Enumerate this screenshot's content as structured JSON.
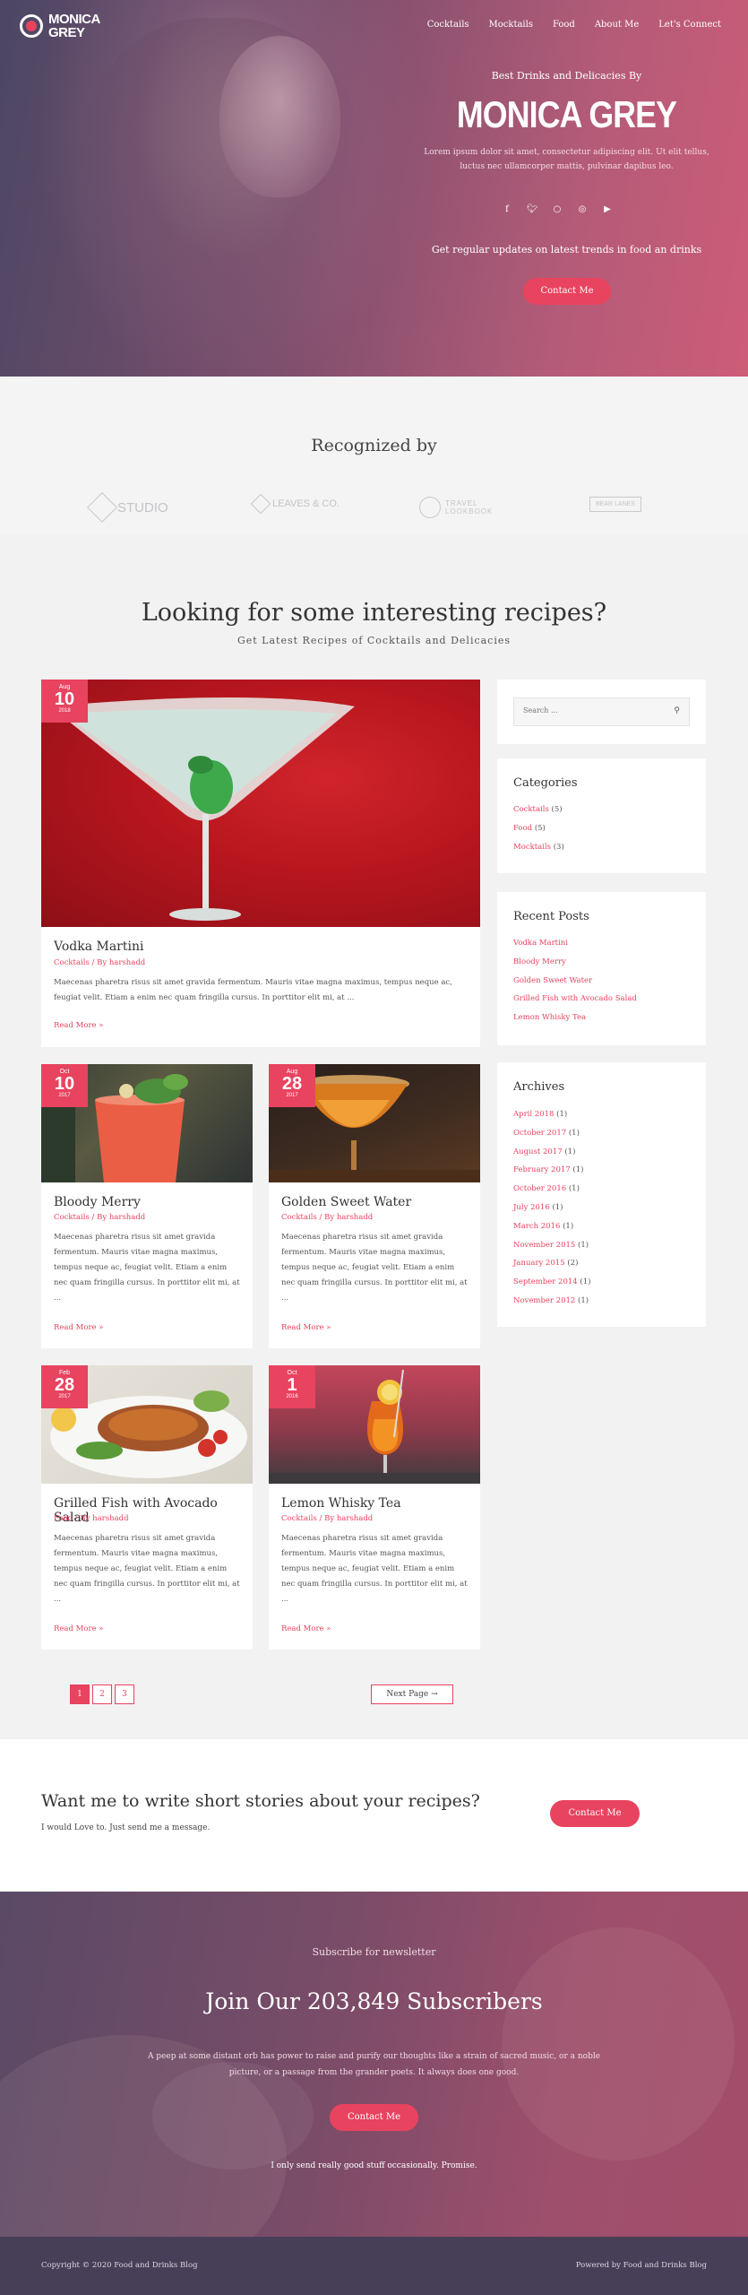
{
  "brand": {
    "line1": "MONICA",
    "line2": "GREY"
  },
  "nav": [
    "Cocktails",
    "Mocktails",
    "Food",
    "About Me",
    "Let's Connect"
  ],
  "hero": {
    "kicker": "Best Drinks and Delicacies By",
    "title": "MONICA GREY",
    "desc": "Lorem ipsum dolor sit amet, consectetur adipiscing elit. Ut elit tellus, luctus nec ullamcorper mattis, pulvinar dapibus leo.",
    "social_icons": [
      "facebook-icon",
      "twitter-icon",
      "instagram-icon",
      "tripadvisor-icon",
      "youtube-icon"
    ],
    "updates": "Get regular updates on latest trends in food an drinks",
    "button": "Contact Me"
  },
  "recognized": {
    "title": "Recognized by",
    "logos": [
      "STUDIO",
      "LEAVES & CO.",
      "TRAVEL LOOKBOOK",
      "BEAR LANES"
    ]
  },
  "recipes": {
    "title": "Looking for some interesting recipes?",
    "subtitle": "Get Latest Recipes of Cocktails and Delicacies"
  },
  "posts": [
    {
      "title": "Vodka Martini",
      "meta": "Cocktails / By harshadd",
      "month": "Aug",
      "day": "10",
      "year": "2018",
      "excerpt": "Maecenas pharetra risus sit amet gravida fermentum. Mauris vitae magna maximus, tempus neque ac, feugiat velit. Etiam a enim nec quam fringilla cursus. In porttitor elit mi, at ...",
      "more": "Read More »"
    },
    {
      "title": "Bloody Merry",
      "meta": "Cocktails / By harshadd",
      "month": "Oct",
      "day": "10",
      "year": "2017",
      "excerpt": "Maecenas pharetra risus sit amet gravida fermentum. Mauris vitae magna maximus, tempus neque ac, feugiat velit. Etiam a enim nec quam fringilla cursus. In porttitor elit mi, at ...",
      "more": "Read More »"
    },
    {
      "title": "Golden Sweet Water",
      "meta": "Cocktails / By harshadd",
      "month": "Aug",
      "day": "28",
      "year": "2017",
      "excerpt": "Maecenas pharetra risus sit amet gravida fermentum. Mauris vitae magna maximus, tempus neque ac, feugiat velit. Etiam a enim nec quam fringilla cursus. In porttitor elit mi, at ...",
      "more": "Read More »"
    },
    {
      "title": "Grilled Fish with Avocado Salad",
      "meta": "Food / By harshadd",
      "month": "Feb",
      "day": "28",
      "year": "2017",
      "excerpt": "Maecenas pharetra risus sit amet gravida fermentum. Mauris vitae magna maximus, tempus neque ac, feugiat velit. Etiam a enim nec quam fringilla cursus. In porttitor elit mi, at ...",
      "more": "Read More »"
    },
    {
      "title": "Lemon Whisky Tea",
      "meta": "Cocktails / By harshadd",
      "month": "Oct",
      "day": "1",
      "year": "2016",
      "excerpt": "Maecenas pharetra risus sit amet gravida fermentum. Mauris vitae magna maximus, tempus neque ac, feugiat velit. Etiam a enim nec quam fringilla cursus. In porttitor elit mi, at ...",
      "more": "Read More »"
    }
  ],
  "sidebar": {
    "search_placeholder": "Search ...",
    "categories": {
      "title": "Categories",
      "items": [
        {
          "name": "Cocktails",
          "count": "(5)"
        },
        {
          "name": "Food",
          "count": "(5)"
        },
        {
          "name": "Mocktails",
          "count": "(3)"
        }
      ]
    },
    "recent": {
      "title": "Recent Posts",
      "items": [
        "Vodka Martini",
        "Bloody Merry",
        "Golden Sweet Water",
        "Grilled Fish with Avocado Salad",
        "Lemon Whisky Tea"
      ]
    },
    "archives": {
      "title": "Archives",
      "items": [
        {
          "name": "April 2018",
          "count": "(1)"
        },
        {
          "name": "October 2017",
          "count": "(1)"
        },
        {
          "name": "August 2017",
          "count": "(1)"
        },
        {
          "name": "February 2017",
          "count": "(1)"
        },
        {
          "name": "October 2016",
          "count": "(1)"
        },
        {
          "name": "July 2016",
          "count": "(1)"
        },
        {
          "name": "March 2016",
          "count": "(1)"
        },
        {
          "name": "November 2015",
          "count": "(1)"
        },
        {
          "name": "January 2015",
          "count": "(2)"
        },
        {
          "name": "September 2014",
          "count": "(1)"
        },
        {
          "name": "November 2012",
          "count": "(1)"
        }
      ]
    }
  },
  "pagination": {
    "pages": [
      "1",
      "2",
      "3"
    ],
    "next": "Next Page →"
  },
  "cta": {
    "title": "Want me to write short stories about your recipes?",
    "text": "I would Love to. Just send me a message.",
    "button": "Contact Me"
  },
  "newsletter": {
    "kicker": "Subscribe for newsletter",
    "title": "Join Our 203,849 Subscribers",
    "desc": "A peep at some distant orb has power to raise and purify our thoughts like a strain of sacred music, or a noble picture, or a passage from the grander poets. It always does one good.",
    "button": "Contact Me",
    "promise": "I only send really good stuff occasionally. Promise."
  },
  "footer": {
    "copyright": "Copyright © 2020 Food and Drinks Blog",
    "powered": "Powered by Food and Drinks Blog"
  },
  "colors": {
    "accent": "#e8435f",
    "footer": "#473f57"
  }
}
